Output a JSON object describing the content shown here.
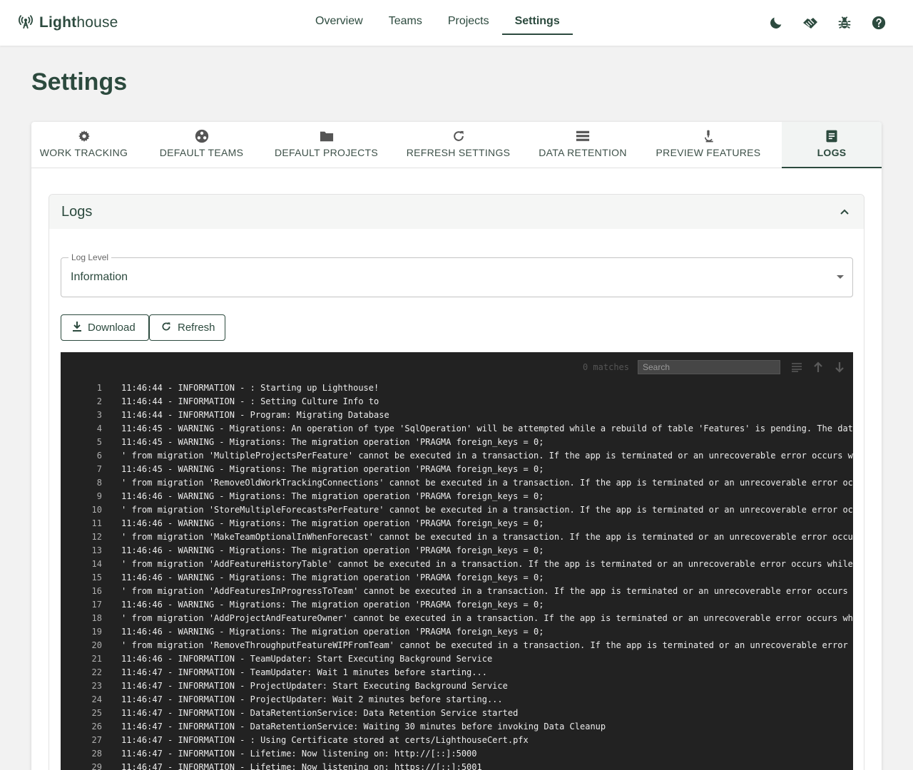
{
  "app": {
    "brand_bold": "Light",
    "brand_light": "house"
  },
  "nav": [
    {
      "label": "Overview"
    },
    {
      "label": "Teams"
    },
    {
      "label": "Projects"
    },
    {
      "label": "Settings",
      "active": true
    }
  ],
  "top_icons": [
    "moon-icon",
    "handshake-icon",
    "bug-icon",
    "help-icon"
  ],
  "page": {
    "title": "Settings"
  },
  "tabs": [
    {
      "label": "WORK TRACKING",
      "icon": "gear-icon"
    },
    {
      "label": "DEFAULT TEAMS",
      "icon": "team-icon"
    },
    {
      "label": "DEFAULT PROJECTS",
      "icon": "folder-icon"
    },
    {
      "label": "REFRESH SETTINGS",
      "icon": "refresh-icon"
    },
    {
      "label": "DATA RETENTION",
      "icon": "storage-icon"
    },
    {
      "label": "PREVIEW FEATURES",
      "icon": "microscope-icon"
    },
    {
      "label": "LOGS",
      "icon": "document-icon",
      "active": true
    }
  ],
  "logs": {
    "title": "Logs",
    "log_level_label": "Log Level",
    "log_level_value": "Information",
    "download_label": "Download",
    "refresh_label": "Refresh",
    "matches": "0 matches",
    "search_placeholder": "Search",
    "lines": [
      {
        "n": "1",
        "text": "11:46:44 - INFORMATION - : Starting up Lighthouse!"
      },
      {
        "n": "2",
        "text": "11:46:44 - INFORMATION - : Setting Culture Info to"
      },
      {
        "n": "3",
        "text": "11:46:44 - INFORMATION - Program: Migrating Database"
      },
      {
        "n": "4",
        "text": "11:46:45 - WARNING - Migrations: An operation of type 'SqlOperation' will be attempted while a rebuild of table 'Features' is pending. The dat"
      },
      {
        "n": "5",
        "text": "11:46:45 - WARNING - Migrations: The migration operation 'PRAGMA foreign_keys = 0;"
      },
      {
        "n": "6",
        "text": "' from migration 'MultipleProjectsPerFeature' cannot be executed in a transaction. If the app is terminated or an unrecoverable error occurs w"
      },
      {
        "n": "7",
        "text": "11:46:45 - WARNING - Migrations: The migration operation 'PRAGMA foreign_keys = 0;"
      },
      {
        "n": "8",
        "text": "' from migration 'RemoveOldWorkTrackingConnections' cannot be executed in a transaction. If the app is terminated or an unrecoverable error oc"
      },
      {
        "n": "9",
        "text": "11:46:46 - WARNING - Migrations: The migration operation 'PRAGMA foreign_keys = 0;"
      },
      {
        "n": "10",
        "text": "' from migration 'StoreMultipleForecastsPerFeature' cannot be executed in a transaction. If the app is terminated or an unrecoverable error oc"
      },
      {
        "n": "11",
        "text": "11:46:46 - WARNING - Migrations: The migration operation 'PRAGMA foreign_keys = 0;"
      },
      {
        "n": "12",
        "text": "' from migration 'MakeTeamOptionalInWhenForecast' cannot be executed in a transaction. If the app is terminated or an unrecoverable error occu"
      },
      {
        "n": "13",
        "text": "11:46:46 - WARNING - Migrations: The migration operation 'PRAGMA foreign_keys = 0;"
      },
      {
        "n": "14",
        "text": "' from migration 'AddFeatureHistoryTable' cannot be executed in a transaction. If the app is terminated or an unrecoverable error occurs while"
      },
      {
        "n": "15",
        "text": "11:46:46 - WARNING - Migrations: The migration operation 'PRAGMA foreign_keys = 0;"
      },
      {
        "n": "16",
        "text": "' from migration 'AddFeaturesInProgressToTeam' cannot be executed in a transaction. If the app is terminated or an unrecoverable error occurs"
      },
      {
        "n": "17",
        "text": "11:46:46 - WARNING - Migrations: The migration operation 'PRAGMA foreign_keys = 0;"
      },
      {
        "n": "18",
        "text": "' from migration 'AddProjectAndFeatureOwner' cannot be executed in a transaction. If the app is terminated or an unrecoverable error occurs wh"
      },
      {
        "n": "19",
        "text": "11:46:46 - WARNING - Migrations: The migration operation 'PRAGMA foreign_keys = 0;"
      },
      {
        "n": "20",
        "text": "' from migration 'RemoveThroughputFeatureWIPFromTeam' cannot be executed in a transaction. If the app is terminated or an unrecoverable error"
      },
      {
        "n": "21",
        "text": "11:46:46 - INFORMATION - TeamUpdater: Start Executing Background Service"
      },
      {
        "n": "22",
        "text": "11:46:47 - INFORMATION - TeamUpdater: Wait 1 minutes before starting..."
      },
      {
        "n": "23",
        "text": "11:46:47 - INFORMATION - ProjectUpdater: Start Executing Background Service"
      },
      {
        "n": "24",
        "text": "11:46:47 - INFORMATION - ProjectUpdater: Wait 2 minutes before starting..."
      },
      {
        "n": "25",
        "text": "11:46:47 - INFORMATION - DataRetentionService: Data Retention Service started"
      },
      {
        "n": "26",
        "text": "11:46:47 - INFORMATION - DataRetentionService: Waiting 30 minutes before invoking Data Cleanup"
      },
      {
        "n": "27",
        "text": "11:46:47 - INFORMATION - : Using Certificate stored at certs/LighthouseCert.pfx"
      },
      {
        "n": "28",
        "text": "11:46:47 - INFORMATION - Lifetime: Now listening on: http://[::]:5000"
      },
      {
        "n": "29",
        "text": "11:46:47 - INFORMATION - Lifetime: Now listening on: https://[::]:5001"
      }
    ]
  },
  "colors": {
    "primary": "#2c4a3e",
    "log_background": "#222222",
    "page_background": "#f2f2f2"
  }
}
